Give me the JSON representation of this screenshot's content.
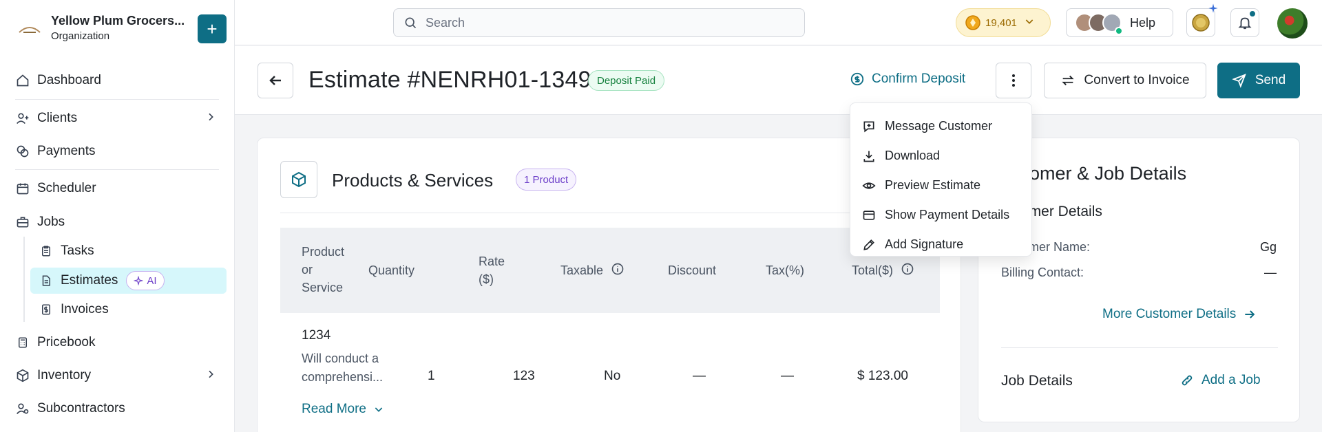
{
  "org": {
    "name": "Yellow Plum Grocers...",
    "subtitle": "Organization",
    "add_label": "+"
  },
  "sidebar": {
    "items": [
      {
        "label": "Dashboard"
      },
      {
        "label": "Clients"
      },
      {
        "label": "Payments"
      },
      {
        "label": "Scheduler"
      },
      {
        "label": "Jobs"
      },
      {
        "label": "Pricebook"
      },
      {
        "label": "Inventory"
      },
      {
        "label": "Subcontractors"
      }
    ],
    "sub_items": [
      {
        "label": "Tasks"
      },
      {
        "label": "Estimates",
        "badge": "AI"
      },
      {
        "label": "Invoices"
      }
    ]
  },
  "topbar": {
    "search_placeholder": "Search",
    "coins": "19,401",
    "help_label": "Help"
  },
  "header": {
    "title": "Estimate #NENRH01-1349",
    "status": "Deposit Paid",
    "confirm_deposit": "Confirm Deposit",
    "convert_label": "Convert to Invoice",
    "send_label": "Send"
  },
  "dropdown": {
    "items": [
      {
        "label": "Message Customer"
      },
      {
        "label": "Download"
      },
      {
        "label": "Preview Estimate"
      },
      {
        "label": "Show Payment Details"
      },
      {
        "label": "Add Signature"
      }
    ]
  },
  "products": {
    "title": "Products & Services",
    "badge": "1 Product",
    "columns": [
      "Product or Service",
      "Quantity",
      "Rate ($)",
      "Taxable",
      "Discount",
      "Tax(%)",
      "Total($)"
    ],
    "column_lines": {
      "product": [
        "Product",
        "or",
        "Service"
      ],
      "rate": [
        "Rate",
        "($)"
      ]
    },
    "rows": [
      {
        "name": "1234",
        "desc_line1": "Will conduct a",
        "desc_line2": "comprehensi...",
        "quantity": "1",
        "rate": "123",
        "taxable": "No",
        "discount": "—",
        "tax": "—",
        "total": "$ 123.00"
      }
    ],
    "read_more": "Read More"
  },
  "customer": {
    "title_visible": "stomer & Job Details",
    "subtitle_visible": "omer Details",
    "name_label_visible": "tomer Name:",
    "name_value": "Gg",
    "billing_label": "Billing Contact:",
    "billing_value": "—",
    "more_link": "More Customer Details",
    "job_title": "Job Details",
    "add_job": "Add a Job"
  },
  "colors": {
    "accent": "#0e6e85",
    "status_green": "#15803d",
    "ai_purple": "#6d3fc9",
    "coins_gold": "#9a6a00"
  }
}
